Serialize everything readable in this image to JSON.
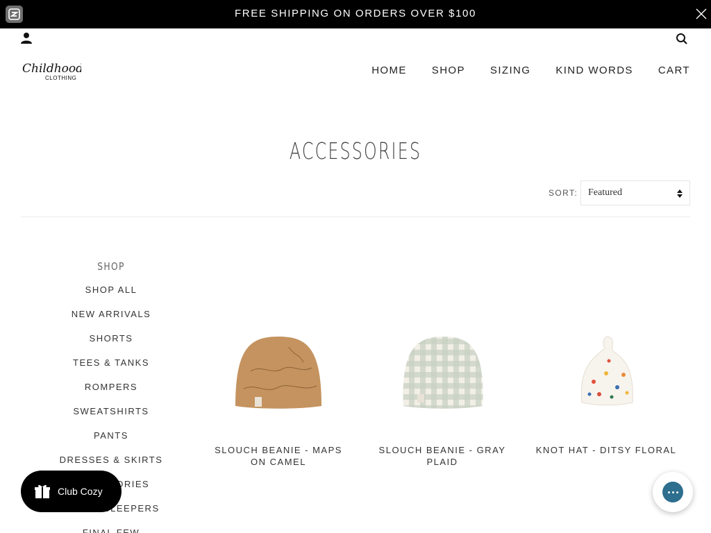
{
  "announcement": {
    "text": "FREE SHIPPING ON ORDERS OVER $100"
  },
  "brand": {
    "logo_line1": "Childhoods",
    "logo_line2": "CLOTHING"
  },
  "nav": {
    "items": [
      "HOME",
      "SHOP",
      "SIZING",
      "KIND WORDS",
      "CART"
    ]
  },
  "page": {
    "title": "ACCESSORIES"
  },
  "sort": {
    "label": "SORT:",
    "value": "Featured"
  },
  "sidebar": {
    "heading": "SHOP",
    "items": [
      "SHOP ALL",
      "NEW ARRIVALS",
      "SHORTS",
      "TEES & TANKS",
      "ROMPERS",
      "SWEATSHIRTS",
      "PANTS",
      "DRESSES & SKIRTS",
      "ACCESSORIES",
      "SWEET SLEEPERS",
      "FINAL FEW"
    ]
  },
  "products": [
    {
      "name": "SLOUCH BEANIE - MAPS ON CAMEL",
      "color": "#c4935f"
    },
    {
      "name": "SLOUCH BEANIE - GRAY PLAID",
      "color": "#d9ddd2"
    },
    {
      "name": "KNOT HAT - DITSY FLORAL",
      "color": "#f7f4ee"
    }
  ],
  "club": {
    "label": "Club Cozy"
  },
  "icons": {
    "account": "user-icon",
    "search": "search-icon",
    "close": "close-icon",
    "gift": "gift-icon",
    "chat": "chat-icon"
  }
}
